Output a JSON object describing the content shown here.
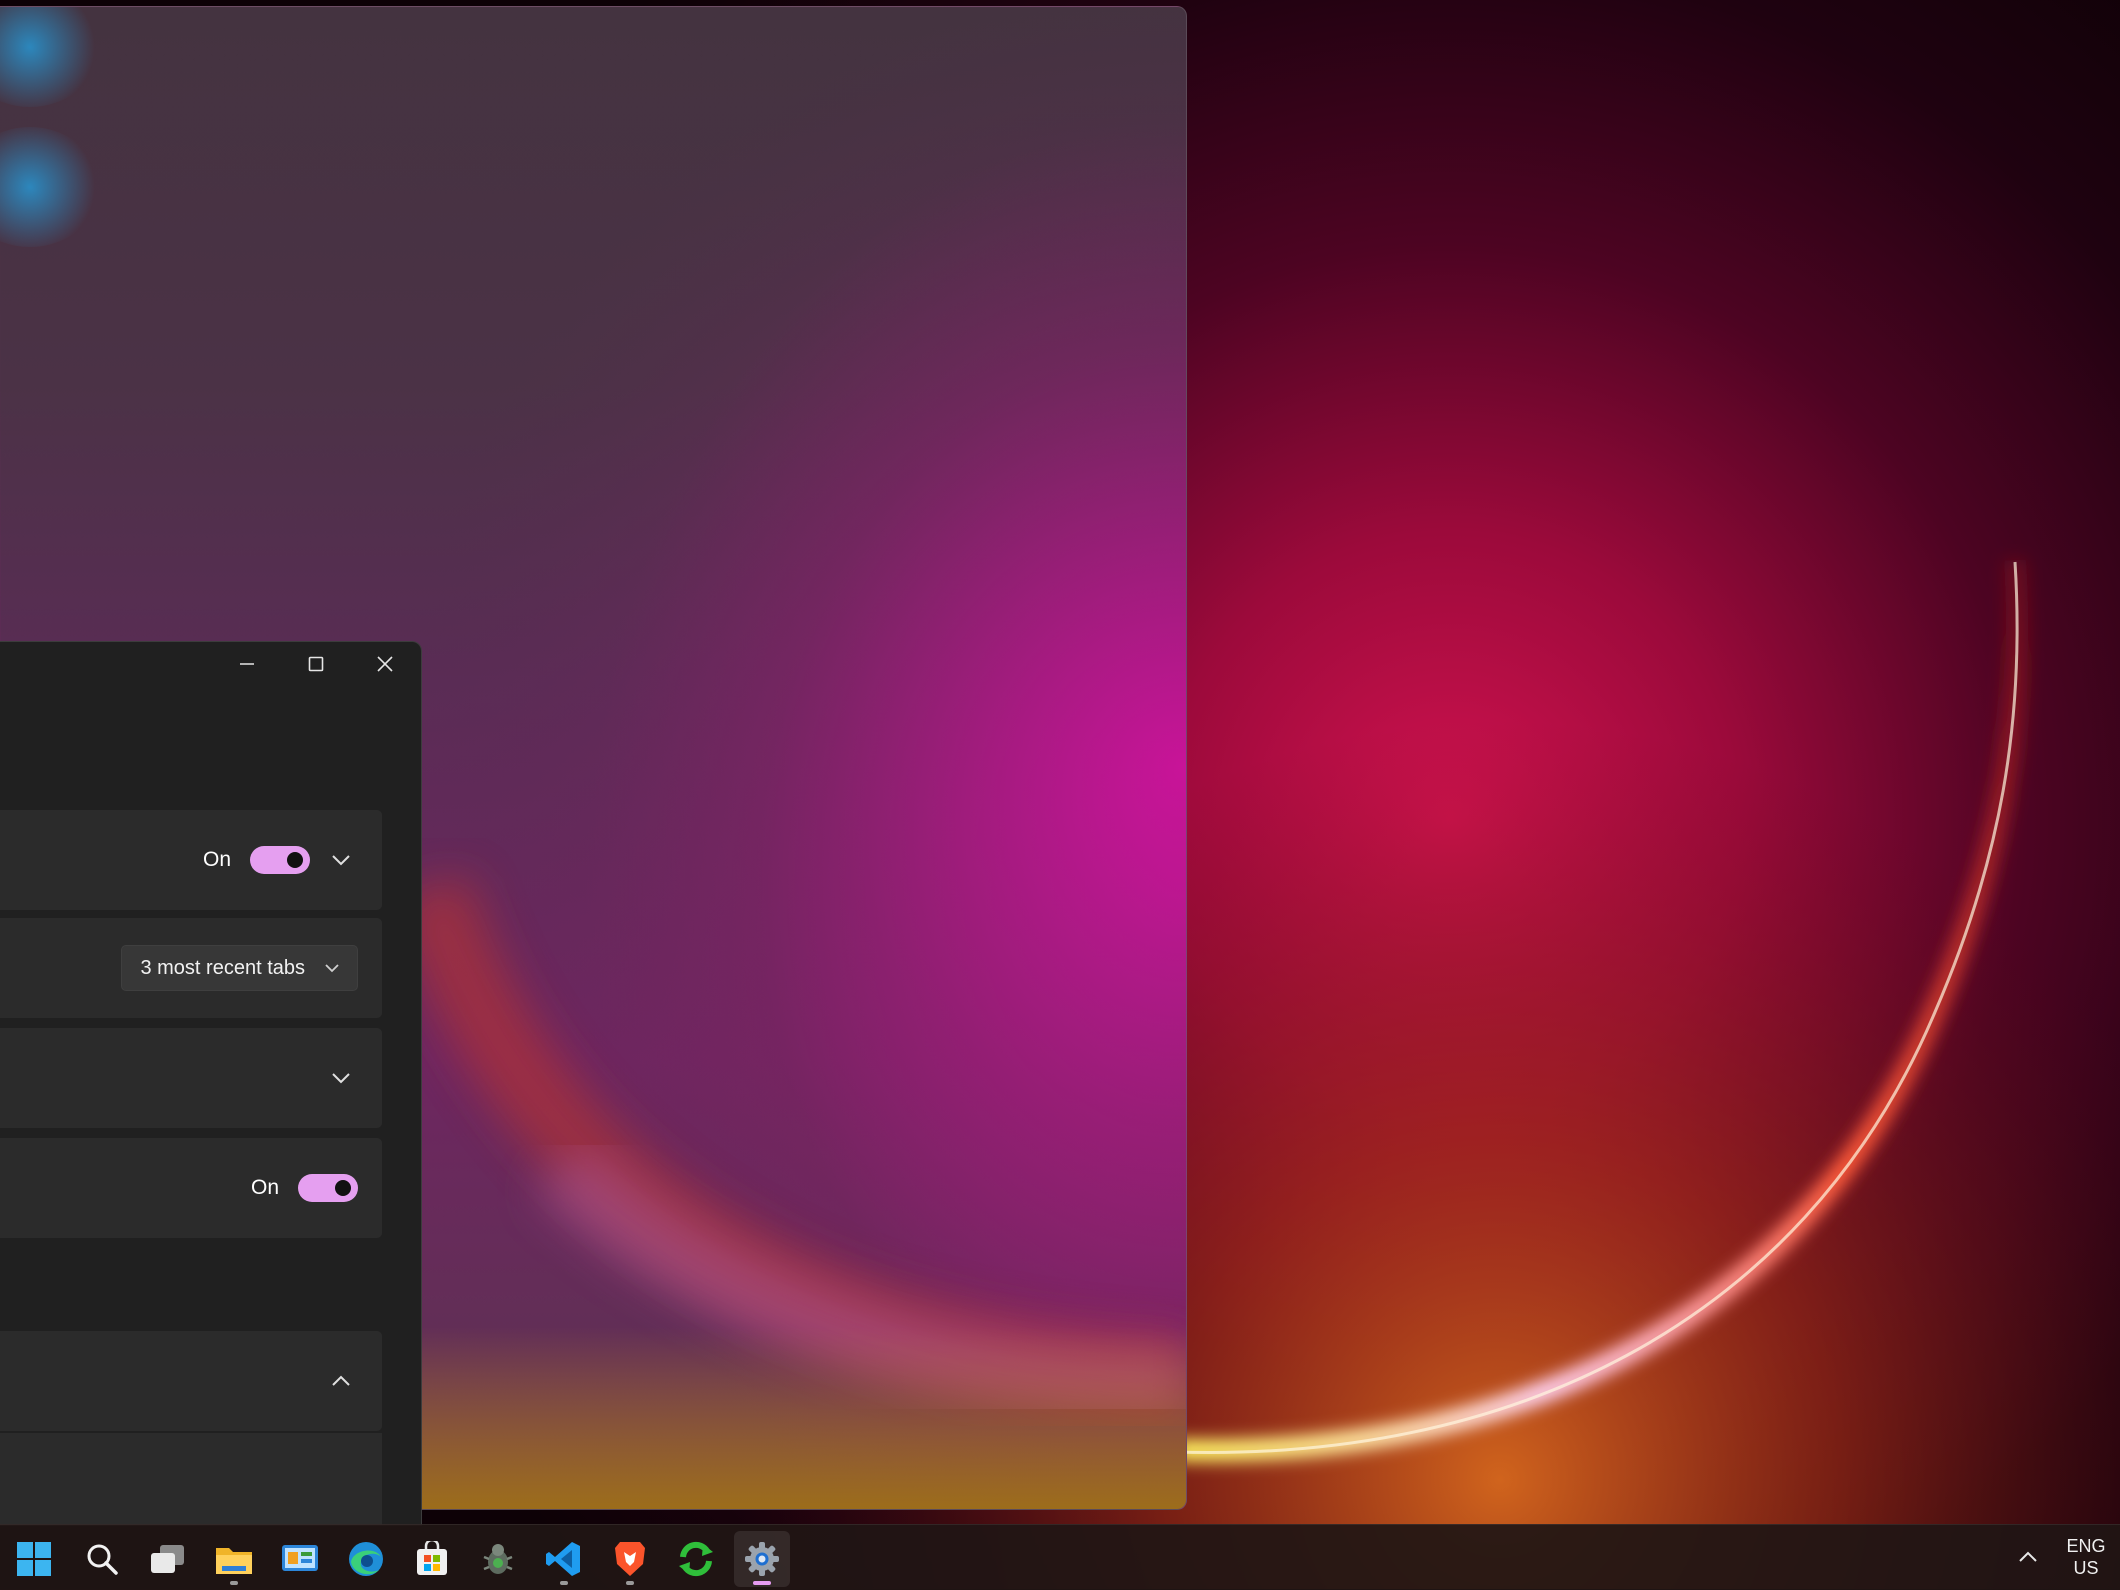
{
  "settings_window": {
    "caption": {
      "minimize": "minimize",
      "maximize": "maximize",
      "close": "close"
    },
    "rows": [
      {
        "state": "On",
        "toggle_on": true,
        "expanded": false
      },
      {
        "dropdown_value": "3 most recent tabs"
      },
      {
        "expanded": false
      },
      {
        "state": "On",
        "toggle_on": true
      },
      {
        "expanded": true
      }
    ]
  },
  "taskbar": {
    "apps": [
      {
        "name": "start",
        "icon": "windows-start-icon"
      },
      {
        "name": "search",
        "icon": "search-icon"
      },
      {
        "name": "task-view",
        "icon": "task-view-icon"
      },
      {
        "name": "file-explorer",
        "icon": "folder-icon",
        "running": true
      },
      {
        "name": "control-panel",
        "icon": "control-panel-icon"
      },
      {
        "name": "edge",
        "icon": "edge-browser-icon"
      },
      {
        "name": "store",
        "icon": "microsoft-store-icon"
      },
      {
        "name": "bug-app",
        "icon": "bug-icon"
      },
      {
        "name": "vscode",
        "icon": "vscode-icon",
        "running": true
      },
      {
        "name": "brave",
        "icon": "brave-browser-icon",
        "running": true
      },
      {
        "name": "sync-app",
        "icon": "sync-icon"
      },
      {
        "name": "settings",
        "icon": "settings-gear-icon",
        "running": true,
        "active": true
      }
    ],
    "tray": {
      "language": "ENG",
      "region": "US"
    }
  },
  "colors": {
    "accent": "#e59ff0",
    "window_bg": "#202020",
    "card_bg": "#2b2b2b"
  }
}
